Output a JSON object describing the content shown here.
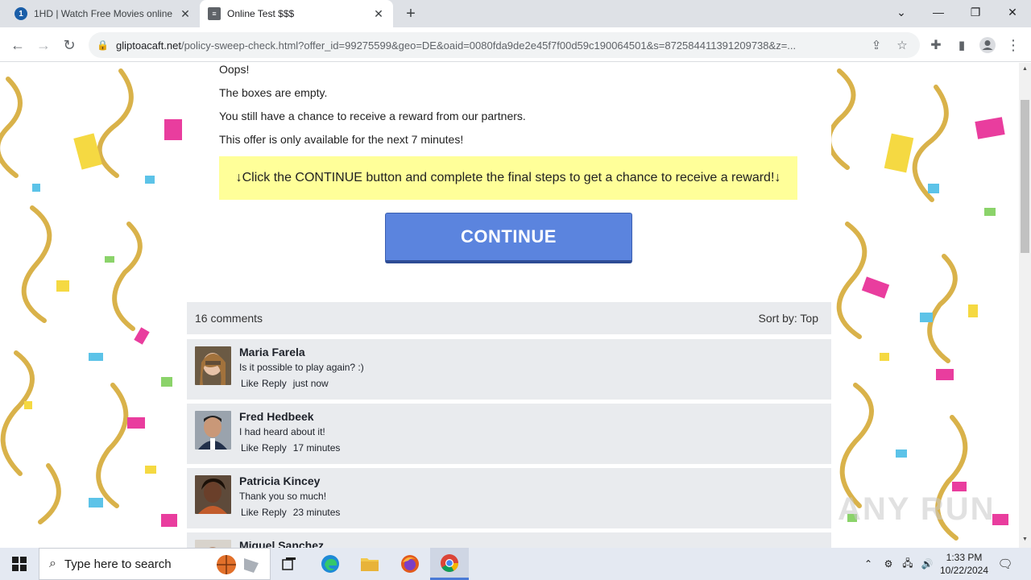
{
  "browser": {
    "tabs": [
      {
        "title": "1HD | Watch Free Movies online",
        "favicon": "1"
      },
      {
        "title": "Online Test $$$",
        "favicon": "doc"
      }
    ],
    "url_domain": "gliptoacaft.net",
    "url_rest": "/policy-sweep-check.html?offer_id=99275599&geo=DE&oaid=0080fda9de2e45f7f00d59c190064501&s=872584411391209738&z=..."
  },
  "page": {
    "oops": "Oops!",
    "empty": "The boxes are empty.",
    "chance": "You still have a chance to receive a reward from our partners.",
    "offer": "This offer is only available for the next 7 minutes!",
    "notice": "↓Click the CONTINUE button and complete the final steps to get a chance to receive a reward!↓",
    "continue_label": "CONTINUE"
  },
  "comments": {
    "count_label": "16 comments",
    "sort_label": "Sort by:",
    "sort_value": "Top",
    "items": [
      {
        "name": "Maria Farela",
        "text": "Is it possible to play again? :)",
        "like": "Like",
        "reply": "Reply",
        "time": "just now"
      },
      {
        "name": "Fred Hedbeek",
        "text": "I had heard about it!",
        "like": "Like",
        "reply": "Reply",
        "time": "17 minutes"
      },
      {
        "name": "Patricia Kincey",
        "text": "Thank you so much!",
        "like": "Like",
        "reply": "Reply",
        "time": "23 minutes"
      },
      {
        "name": "Miguel Sanchez",
        "text": "",
        "like": "",
        "reply": "",
        "time": ""
      }
    ]
  },
  "watermark": "ANY RUN",
  "taskbar": {
    "search_placeholder": "Type here to search",
    "time": "1:33 PM",
    "date": "10/22/2024"
  }
}
